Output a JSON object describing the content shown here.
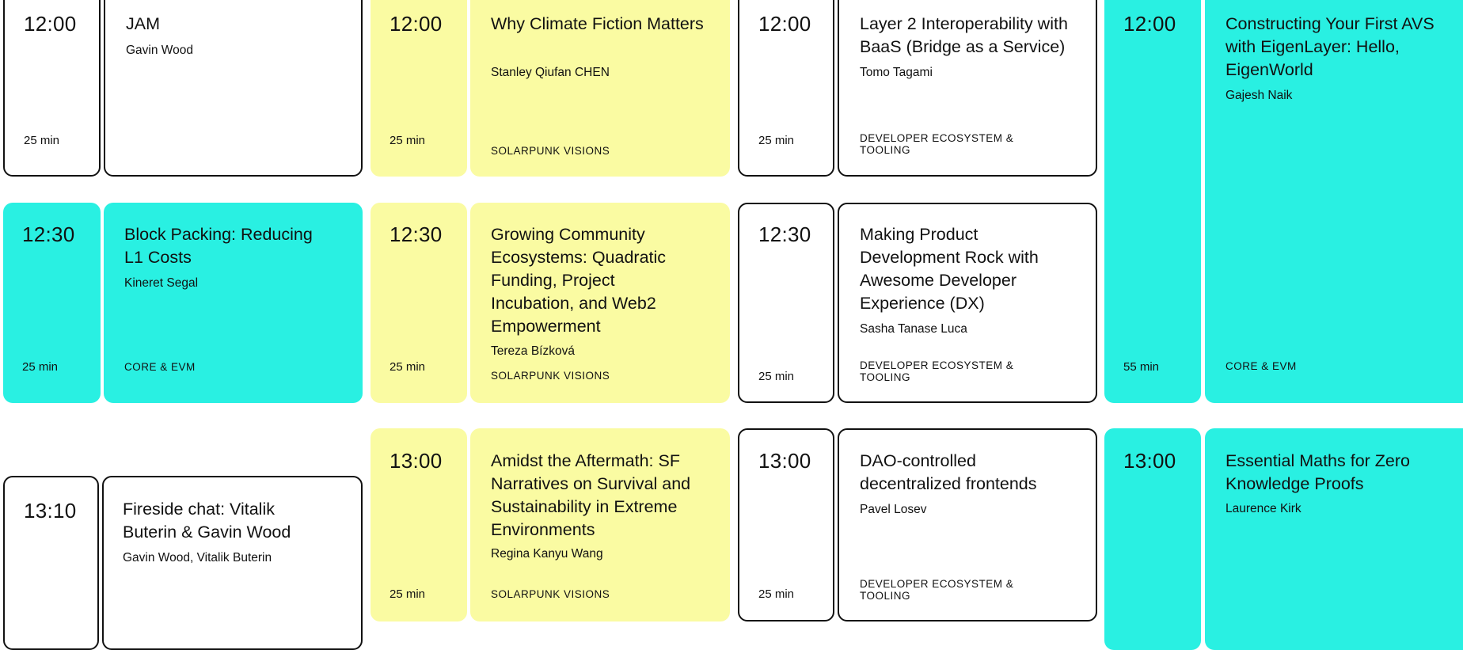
{
  "colors": {
    "cyan": "#29f0e2",
    "yellow": "#fafba2",
    "border": "#111111"
  },
  "sessions": [
    {
      "time": "12:00",
      "duration": "25 min",
      "title": "JAM",
      "speaker": "Gavin Wood",
      "track": ""
    },
    {
      "time": "12:00",
      "duration": "25 min",
      "title": "Why Climate Fiction Matters",
      "speaker": "Stanley Qiufan CHEN",
      "track": "SOLARPUNK VISIONS"
    },
    {
      "time": "12:00",
      "duration": "25 min",
      "title": "Layer 2 Interoperability with BaaS (Bridge as a Service)",
      "speaker": "Tomo Tagami",
      "track": "DEVELOPER ECOSYSTEM & TOOLING"
    },
    {
      "time": "12:00",
      "duration": "55 min",
      "title": "Constructing Your First AVS with EigenLayer: Hello, EigenWorld",
      "speaker": "Gajesh Naik",
      "track": "CORE & EVM"
    },
    {
      "time": "12:30",
      "duration": "25 min",
      "title": "Block Packing: Reducing L1 Costs",
      "speaker": "Kineret Segal",
      "track": "CORE & EVM"
    },
    {
      "time": "12:30",
      "duration": "25 min",
      "title": "Growing Community Ecosystems: Quadratic Funding, Project Incubation, and Web2 Empowerment",
      "speaker": "Tereza Bízková",
      "track": "SOLARPUNK VISIONS"
    },
    {
      "time": "12:30",
      "duration": "25 min",
      "title": "Making Product Development Rock with Awesome Developer Experience (DX)",
      "speaker": "Sasha Tanase Luca",
      "track": "DEVELOPER ECOSYSTEM & TOOLING"
    },
    {
      "time": "13:10",
      "duration": "",
      "title": "Fireside chat: Vitalik Buterin & Gavin Wood",
      "speaker": "Gavin Wood, Vitalik Buterin",
      "track": ""
    },
    {
      "time": "13:00",
      "duration": "25 min",
      "title": "Amidst the Aftermath: SF Narratives on Survival and Sustainability in Extreme Environments",
      "speaker": "Regina Kanyu Wang",
      "track": "SOLARPUNK VISIONS"
    },
    {
      "time": "13:00",
      "duration": "25 min",
      "title": "DAO-controlled decentralized frontends",
      "speaker": "Pavel Losev",
      "track": "DEVELOPER ECOSYSTEM & TOOLING"
    },
    {
      "time": "13:00",
      "duration": "",
      "title": "Essential Maths for Zero Knowledge Proofs",
      "speaker": "Laurence Kirk",
      "track": ""
    }
  ]
}
